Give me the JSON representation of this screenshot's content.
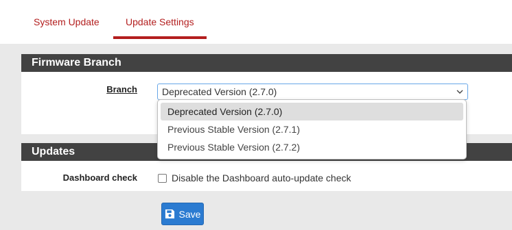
{
  "tabs": [
    {
      "label": "System Update"
    },
    {
      "label": "Update Settings",
      "active": true
    }
  ],
  "firmware": {
    "header": "Firmware Branch",
    "branch_label": "Branch",
    "selected_value": "Deprecated Version (2.7.0)",
    "options": [
      {
        "label": "Deprecated Version (2.7.0)",
        "selected": true
      },
      {
        "label": "Previous Stable Version (2.7.1)"
      },
      {
        "label": "Previous Stable Version (2.7.2)"
      }
    ]
  },
  "updates": {
    "header": "Updates",
    "dashboard_label": "Dashboard check",
    "checkbox_label": "Disable the Dashboard auto-update check",
    "checked": false
  },
  "actions": {
    "save_label": "Save"
  },
  "colors": {
    "accent": "#b31e1e",
    "panel_header": "#424242",
    "primary_button": "#2b7bd1"
  }
}
